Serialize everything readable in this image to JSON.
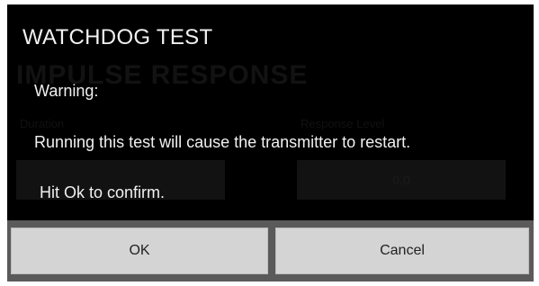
{
  "background": {
    "title": "IMPULSE RESPONSE",
    "left_label": "Duration",
    "right_label": "Response Level",
    "right_field_value": "0.0"
  },
  "dialog": {
    "title": "WATCHDOG TEST",
    "warning": "Warning:",
    "message": "Running this test will cause the transmitter to restart.",
    "confirm": "Hit Ok to confirm.",
    "ok_label": "OK",
    "cancel_label": "Cancel"
  },
  "colors": {
    "dialog_background": "#000000",
    "text": "#f0f0f0",
    "button_background": "#d4d4d4",
    "button_bar": "#5a5a5a"
  }
}
